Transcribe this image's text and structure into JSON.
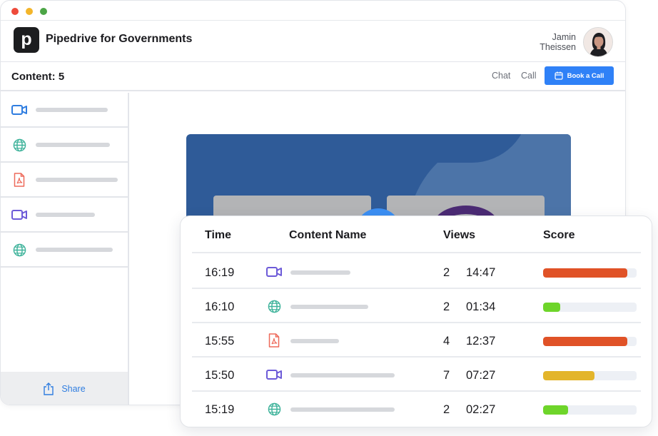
{
  "app": {
    "name": "Pipedrive for Governments",
    "logo_letter": "p"
  },
  "user": {
    "first_name": "Jamin",
    "last_name": "Theissen"
  },
  "toolbar": {
    "content_label": "Content: 5",
    "chat_label": "Chat",
    "call_label": "Call",
    "book_label": "Book a Call"
  },
  "sidebar": {
    "items": [
      {
        "icon": "video-icon"
      },
      {
        "icon": "globe-icon"
      },
      {
        "icon": "pdf-icon"
      },
      {
        "icon": "video-icon"
      },
      {
        "icon": "globe-icon"
      }
    ],
    "share_label": "Share"
  },
  "table": {
    "headers": {
      "time": "Time",
      "name": "Content Name",
      "views": "Views",
      "score": "Score"
    },
    "rows": [
      {
        "time": "16:19",
        "icon": "video-icon",
        "views": "2",
        "duration": "14:47",
        "score": 0.9,
        "score_color": "#e05227"
      },
      {
        "time": "16:10",
        "icon": "globe-icon",
        "views": "2",
        "duration": "01:34",
        "score": 0.18,
        "score_color": "#6ed52a"
      },
      {
        "time": "15:55",
        "icon": "pdf-icon",
        "views": "4",
        "duration": "12:37",
        "score": 0.9,
        "score_color": "#e05227"
      },
      {
        "time": "15:50",
        "icon": "video-icon",
        "views": "7",
        "duration": "07:27",
        "score": 0.55,
        "score_color": "#e3b52b"
      },
      {
        "time": "15:19",
        "icon": "globe-icon",
        "views": "2",
        "duration": "02:27",
        "score": 0.27,
        "score_color": "#6ed52a"
      }
    ]
  },
  "colors": {
    "accent": "#2f81f7",
    "video": "#2f7de0",
    "video_alt": "#6d5bd8",
    "globe": "#3fb39b",
    "pdf": "#ee6a5a"
  }
}
